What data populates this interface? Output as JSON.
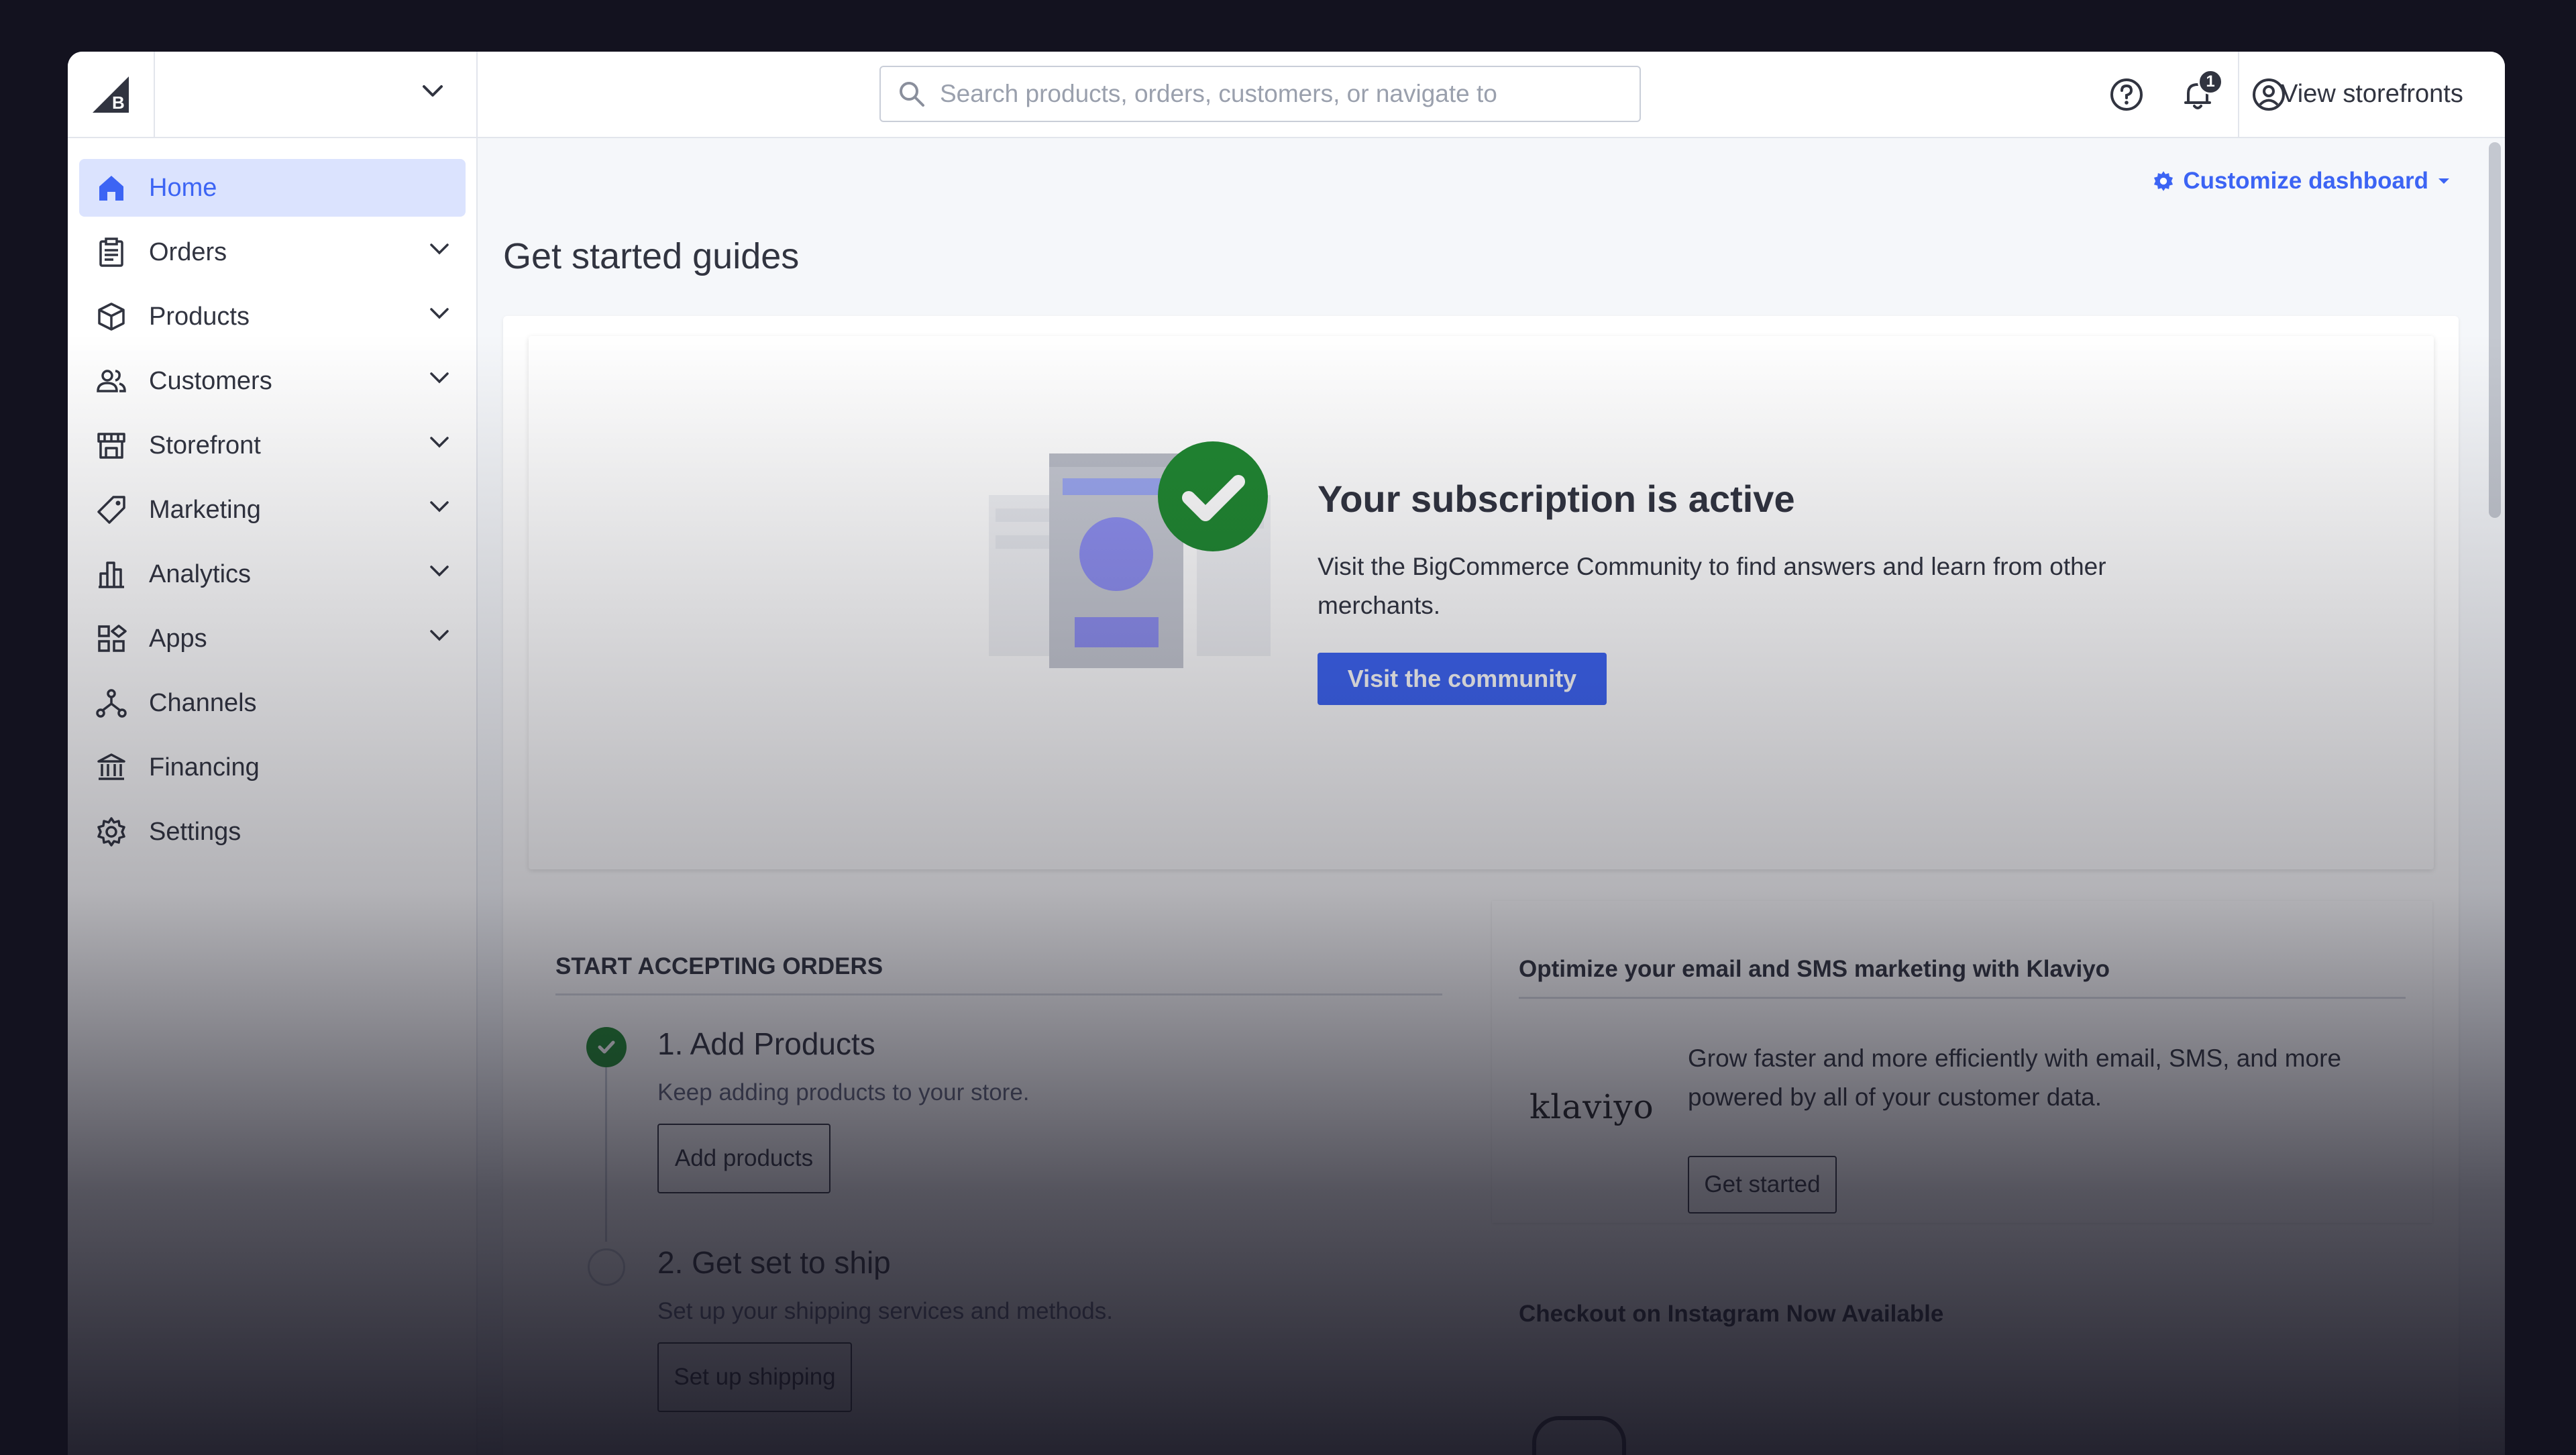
{
  "header": {
    "store_name": "",
    "search_placeholder": "Search products, orders, customers, or navigate to",
    "notification_count": "1",
    "view_storefronts_label": "View storefronts"
  },
  "sidebar": {
    "items": [
      {
        "label": "Home",
        "icon": "home-icon",
        "active": true
      },
      {
        "label": "Orders",
        "icon": "clipboard-icon",
        "expandable": true
      },
      {
        "label": "Products",
        "icon": "box-icon",
        "expandable": true
      },
      {
        "label": "Customers",
        "icon": "people-icon",
        "expandable": true
      },
      {
        "label": "Storefront",
        "icon": "storefront-icon",
        "expandable": true
      },
      {
        "label": "Marketing",
        "icon": "tag-icon",
        "expandable": true
      },
      {
        "label": "Analytics",
        "icon": "bar-chart-icon",
        "expandable": true
      },
      {
        "label": "Apps",
        "icon": "apps-grid-icon",
        "expandable": true
      },
      {
        "label": "Channels",
        "icon": "channels-icon"
      },
      {
        "label": "Financing",
        "icon": "bank-icon"
      },
      {
        "label": "Settings",
        "icon": "gear-icon"
      }
    ]
  },
  "main": {
    "customize_label": "Customize dashboard",
    "page_title": "Get started guides",
    "hero": {
      "title": "Your subscription is active",
      "body": "Visit the BigCommerce Community to find answers and learn from other merchants.",
      "button_label": "Visit the community"
    },
    "orders_panel": {
      "title": "START ACCEPTING ORDERS",
      "steps": [
        {
          "title": "1. Add Products",
          "desc": "Keep adding products to your store.",
          "button": "Add products",
          "done": true
        },
        {
          "title": "2. Get set to ship",
          "desc": "Set up your shipping services and methods.",
          "button": "Set up shipping",
          "done": false
        }
      ]
    },
    "klaviyo_panel": {
      "title": "Optimize your email and SMS marketing with Klaviyo",
      "logo_text": "klaviyo",
      "body": "Grow faster and more efficiently with email, SMS, and more powered by all of your customer data.",
      "button": "Get started"
    },
    "instagram_panel": {
      "title": "Checkout on Instagram Now Available"
    }
  },
  "colors": {
    "accent": "#3c64f4",
    "active_bg": "#dbe3fe",
    "success": "#208831",
    "text": "#313440",
    "backdrop": "#13121f"
  }
}
